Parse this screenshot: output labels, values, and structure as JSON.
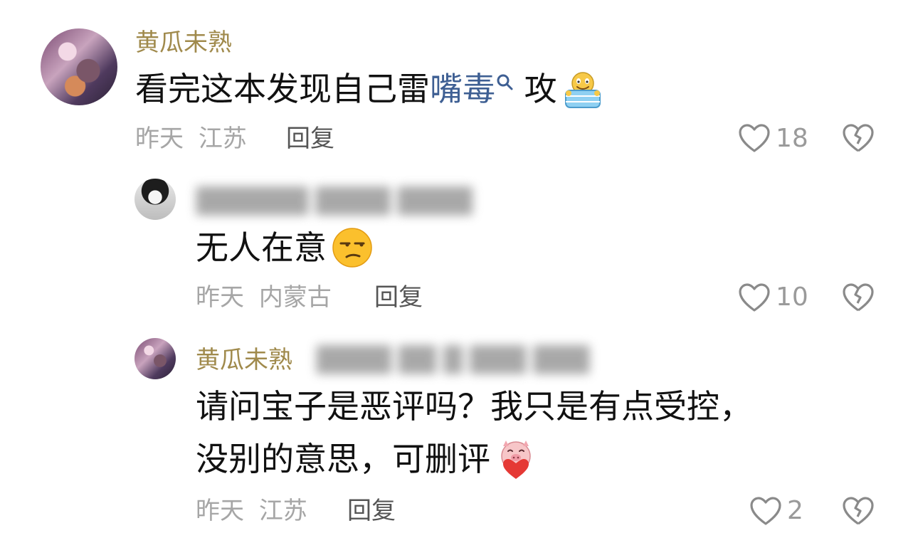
{
  "comments": [
    {
      "author": "黄瓜未熟",
      "text_before": "看完这本发现自己雷",
      "highlight": "嘴毒",
      "text_after": " 攻",
      "emoji": "blanket-smile-emoji",
      "time": "昨天",
      "location": "江苏",
      "reply_label": "回复",
      "likes": "18"
    },
    {
      "author": "",
      "text": "无人在意",
      "emoji": "unamused-face-emoji",
      "time": "昨天",
      "location": "内蒙古",
      "reply_label": "回复",
      "likes": "10"
    },
    {
      "author": "黄瓜未熟",
      "line1": "请问宝子是恶评吗？我只是有点受控，",
      "line2": "没别的意思，可删评",
      "emoji": "pig-heart-emoji",
      "time": "昨天",
      "location": "江苏",
      "reply_label": "回复",
      "likes": "2"
    }
  ],
  "icons": {
    "like": "heart-outline-icon",
    "dislike": "broken-heart-icon",
    "search": "search-icon"
  },
  "colors": {
    "author": "#a08a4c",
    "highlight": "#3e5f93",
    "meta": "#a6a6a6"
  }
}
